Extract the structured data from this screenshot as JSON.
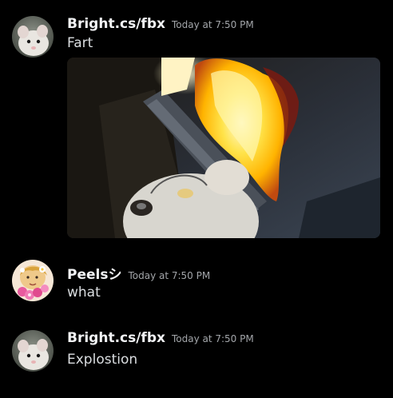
{
  "messages": [
    {
      "author": "Bright.cs/fbx",
      "timestamp": "Today at 7:50 PM",
      "text": "Fart",
      "avatar_icon": "mouse-avatar-icon",
      "has_attachment": true
    },
    {
      "author": "Peelsシ",
      "timestamp": "Today at 7:50 PM",
      "text": "what",
      "avatar_icon": "flower-character-avatar-icon"
    },
    {
      "author": "Bright.cs/fbx",
      "timestamp": "Today at 7:50 PM",
      "text": "Explostion",
      "avatar_icon": "mouse-avatar-icon"
    }
  ],
  "colors": {
    "background": "#000000",
    "username": "#f2f3f5",
    "timestamp": "#a3a6aa",
    "message_text": "#dbdee1",
    "fire": "#ffc21a"
  }
}
